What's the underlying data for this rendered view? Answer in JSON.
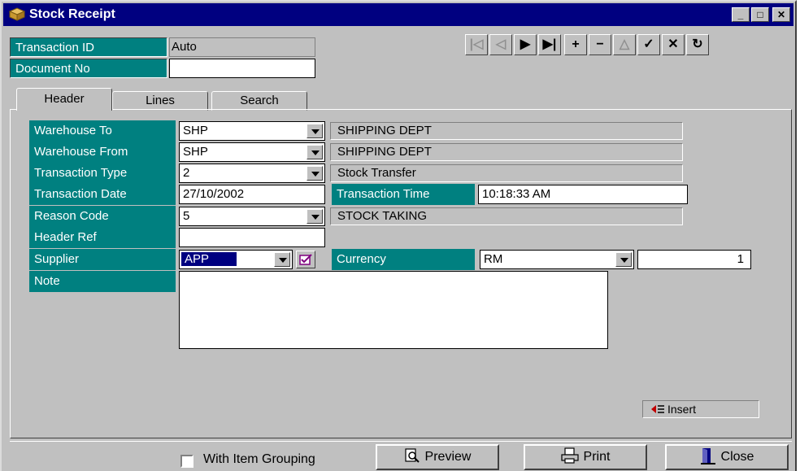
{
  "window": {
    "title": "Stock Receipt",
    "controls": {
      "minimize": "_",
      "maximize": "□",
      "close": "✕"
    }
  },
  "top": {
    "transaction_id_label": "Transaction ID",
    "transaction_id_value": "Auto",
    "document_no_label": "Document No",
    "document_no_value": ""
  },
  "nav": {
    "first": "|◁",
    "prev": "◁",
    "next": "▶",
    "last": "▶|",
    "add": "+",
    "delete": "−",
    "edit": "△",
    "save": "✓",
    "cancel": "✕",
    "refresh": "↻"
  },
  "tabs": [
    "Header",
    "Lines",
    "Search"
  ],
  "form": {
    "warehouse_to_label": "Warehouse To",
    "warehouse_to_code": "SHP",
    "warehouse_to_name": "SHIPPING DEPT",
    "warehouse_from_label": "Warehouse From",
    "warehouse_from_code": "SHP",
    "warehouse_from_name": "SHIPPING DEPT",
    "transaction_type_label": "Transaction Type",
    "transaction_type_code": "2",
    "transaction_type_name": "Stock Transfer",
    "transaction_date_label": "Transaction Date",
    "transaction_date_value": "27/10/2002",
    "transaction_time_label": "Transaction Time",
    "transaction_time_value": "10:18:33 AM",
    "reason_code_label": "Reason Code",
    "reason_code_value": "5",
    "reason_code_name": "STOCK TAKING",
    "header_ref_label": "Header Ref",
    "header_ref_value": "",
    "supplier_label": "Supplier",
    "supplier_value": "APP",
    "currency_label": "Currency",
    "currency_value": "RM",
    "currency_rate": "1",
    "note_label": "Note",
    "note_value": ""
  },
  "insert_button": "Insert",
  "bottom": {
    "with_item_grouping": "With Item Grouping",
    "preview": "Preview",
    "print": "Print",
    "close": "Close"
  },
  "colors": {
    "title_bar": "#000080",
    "label_bg": "#008080",
    "face": "#c0c0c0"
  }
}
